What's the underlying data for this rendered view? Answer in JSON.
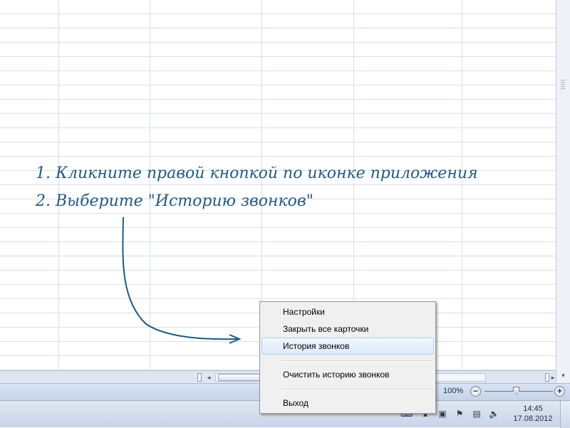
{
  "annotation": {
    "line1": "1. Кликните правой кнопкой по иконке приложения",
    "line2": "2. Выберите \"Историю звонков\"",
    "color": "#1f5a86"
  },
  "context_menu": {
    "items": [
      {
        "label": "Настройки"
      },
      {
        "label": "Закрыть все карточки"
      },
      {
        "label": "История звонков",
        "highlighted": true
      },
      {
        "label": "Очистить историю звонков"
      },
      {
        "label": "Выход"
      }
    ]
  },
  "status_bar": {
    "zoom_label": "100%",
    "zoom_minus": "−",
    "zoom_plus": "+",
    "zoom_percent": 100
  },
  "taskbar": {
    "time": "14:45",
    "date": "17.08.2012",
    "tray_icons": [
      "language-icon",
      "arrow-up-icon",
      "monitor-icon",
      "flag-icon",
      "network-icon",
      "volume-icon"
    ]
  },
  "scrollbars": {
    "left_arrow": "◂",
    "right_arrow": "▸",
    "down_arrow": "▾"
  }
}
